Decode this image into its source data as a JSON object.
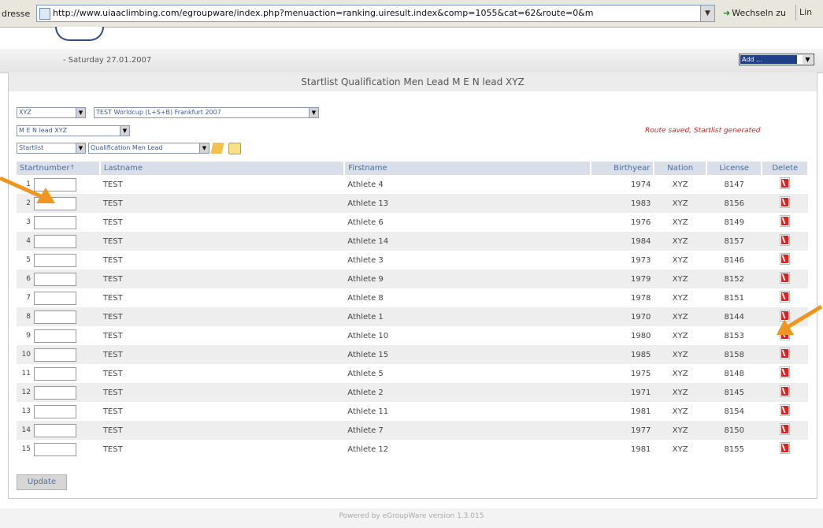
{
  "browser": {
    "address_label": "dresse",
    "url": "http://www.uiaaclimbing.com/egroupware/index.php?menuaction=ranking.uiresult.index&comp=1055&cat=62&route=0&m",
    "go_label": "Wechseln zu",
    "links_label": "Lin"
  },
  "header": {
    "date_text": "- Saturday 27.01.2007",
    "add_select_value": "Add ..."
  },
  "page": {
    "title": "Startlist Qualification Men Lead M E N lead XYZ",
    "status_message": "Route saved, Startlist generated",
    "update_label": "Update",
    "footer_text": "Powered by eGroupWare version 1.3.015"
  },
  "filters": {
    "nation": "XYZ",
    "competition": "TEST Worldcup (L+S+B) Frankfurt 2007",
    "category": "M E N lead XYZ",
    "list_type": "Startlist",
    "route": "Qualification Men Lead"
  },
  "table": {
    "headers": {
      "startnumber": "Startnumber",
      "lastname": "Lastname",
      "firstname": "Firstname",
      "birthyear": "Birthyear",
      "nation": "Nation",
      "license": "License",
      "delete": "Delete"
    },
    "rows": [
      {
        "start": "1",
        "last": "TEST",
        "first": "Athlete 4",
        "year": "1974",
        "nation": "XYZ",
        "license": "8147"
      },
      {
        "start": "2",
        "last": "TEST",
        "first": "Athlete 13",
        "year": "1983",
        "nation": "XYZ",
        "license": "8156"
      },
      {
        "start": "3",
        "last": "TEST",
        "first": "Athlete 6",
        "year": "1976",
        "nation": "XYZ",
        "license": "8149"
      },
      {
        "start": "4",
        "last": "TEST",
        "first": "Athlete 14",
        "year": "1984",
        "nation": "XYZ",
        "license": "8157"
      },
      {
        "start": "5",
        "last": "TEST",
        "first": "Athlete 3",
        "year": "1973",
        "nation": "XYZ",
        "license": "8146"
      },
      {
        "start": "6",
        "last": "TEST",
        "first": "Athlete 9",
        "year": "1979",
        "nation": "XYZ",
        "license": "8152"
      },
      {
        "start": "7",
        "last": "TEST",
        "first": "Athlete 8",
        "year": "1978",
        "nation": "XYZ",
        "license": "8151"
      },
      {
        "start": "8",
        "last": "TEST",
        "first": "Athlete 1",
        "year": "1970",
        "nation": "XYZ",
        "license": "8144"
      },
      {
        "start": "9",
        "last": "TEST",
        "first": "Athlete 10",
        "year": "1980",
        "nation": "XYZ",
        "license": "8153"
      },
      {
        "start": "10",
        "last": "TEST",
        "first": "Athlete 15",
        "year": "1985",
        "nation": "XYZ",
        "license": "8158"
      },
      {
        "start": "11",
        "last": "TEST",
        "first": "Athlete 5",
        "year": "1975",
        "nation": "XYZ",
        "license": "8148"
      },
      {
        "start": "12",
        "last": "TEST",
        "first": "Athlete 2",
        "year": "1971",
        "nation": "XYZ",
        "license": "8145"
      },
      {
        "start": "13",
        "last": "TEST",
        "first": "Athlete 11",
        "year": "1981",
        "nation": "XYZ",
        "license": "8154"
      },
      {
        "start": "14",
        "last": "TEST",
        "first": "Athlete 7",
        "year": "1977",
        "nation": "XYZ",
        "license": "8150"
      },
      {
        "start": "15",
        "last": "TEST",
        "first": "Athlete 12",
        "year": "1981",
        "nation": "XYZ",
        "license": "8155"
      }
    ]
  },
  "colors": {
    "header_bg": "#d8dfe8",
    "header_text": "#4a6ea0",
    "delete_red": "#e02020",
    "status_red": "#d72020",
    "annotation_arrow": "#f0961e"
  },
  "icons": {
    "edit": "edit-icon",
    "new": "new-icon",
    "delete": "delete-icon",
    "sort": "sort-icon"
  }
}
